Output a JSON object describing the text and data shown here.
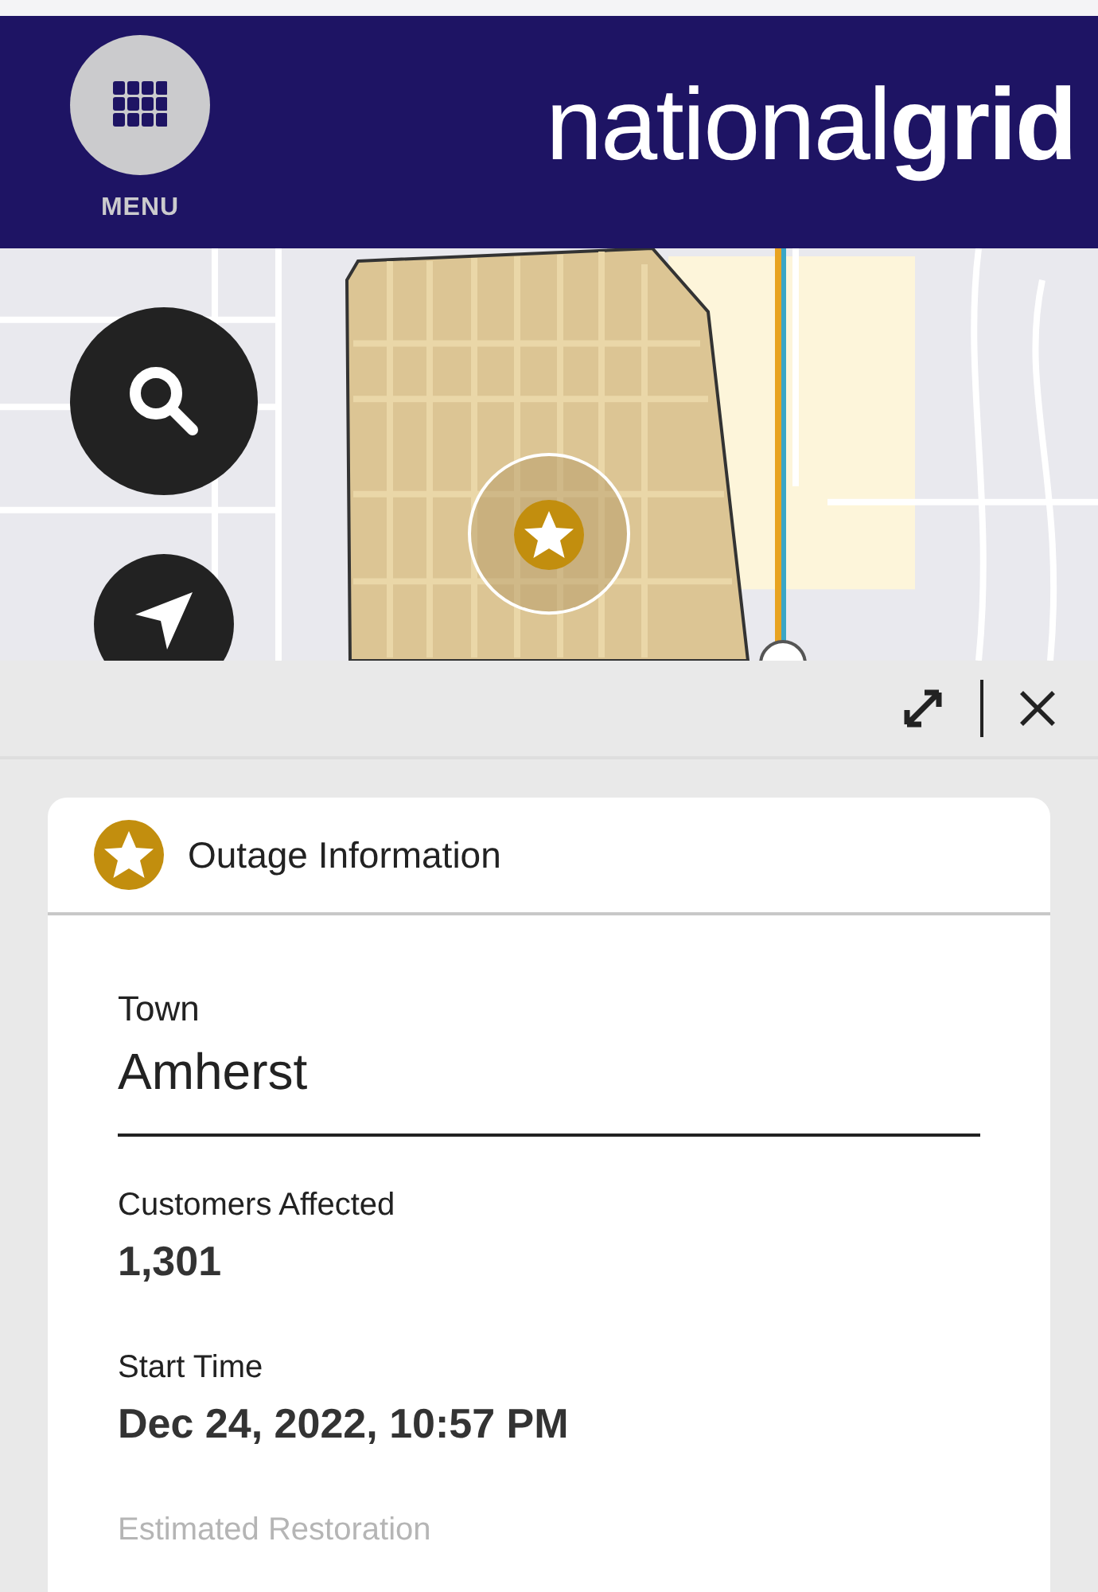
{
  "header": {
    "menu_label": "MENU",
    "logo": "national**grid**"
  },
  "panel": {
    "title": "Outage Information",
    "fields": [
      {
        "label": "Town",
        "value": "Amherst",
        "kind": "primary",
        "faded": false
      },
      {
        "label": "Customers Affected",
        "value": "1,301",
        "kind": "normal",
        "faded": false
      },
      {
        "label": "Start Time",
        "value": "Dec 24, 2022, 10:57 PM",
        "kind": "normal",
        "faded": false
      },
      {
        "label": "Estimated Restoration",
        "kind": "normal",
        "faded": true
      }
    ]
  }
}
